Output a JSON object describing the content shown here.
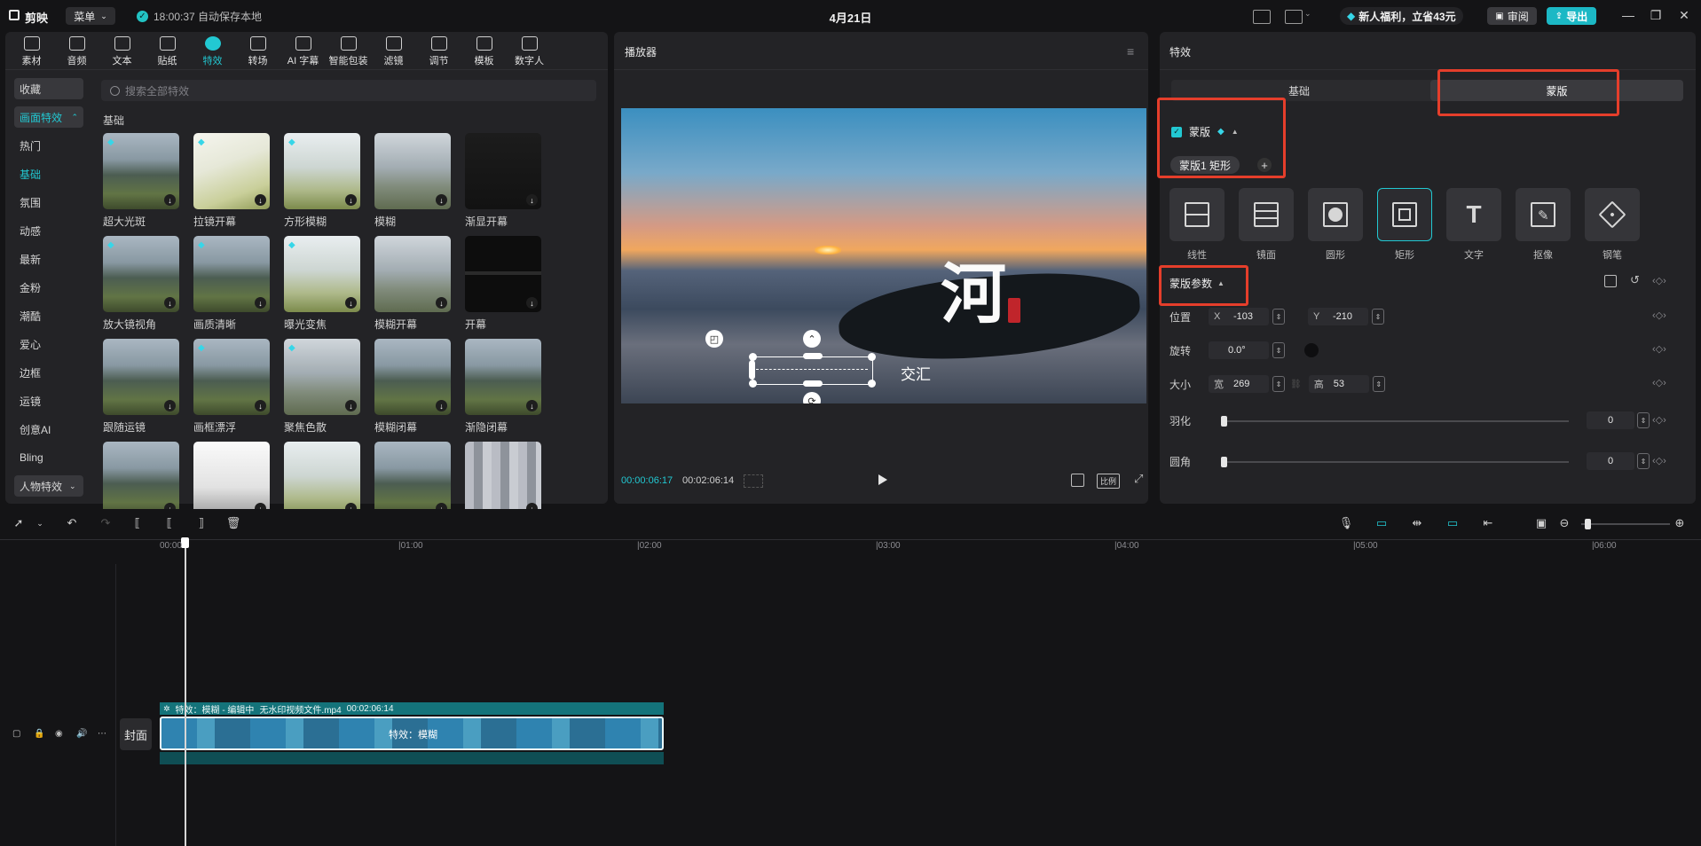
{
  "app": {
    "name": "剪映",
    "menu_label": "菜单",
    "save_status": "18:00:37 自动保存本地",
    "project_title": "4月21日",
    "promo_text": "新人福利，立省43元",
    "review_label": "审阅",
    "export_label": "导出",
    "accent_color": "#22c8d2"
  },
  "toolbar": {
    "tabs": [
      {
        "label": "素材",
        "icon": "media-icon"
      },
      {
        "label": "音频",
        "icon": "audio-icon"
      },
      {
        "label": "文本",
        "icon": "text-icon"
      },
      {
        "label": "贴纸",
        "icon": "sticker-icon"
      },
      {
        "label": "特效",
        "icon": "effects-icon",
        "active": true
      },
      {
        "label": "转场",
        "icon": "transition-icon"
      },
      {
        "label": "AI 字幕",
        "icon": "caption-icon"
      },
      {
        "label": "智能包装",
        "icon": "smart-pack-icon"
      },
      {
        "label": "滤镜",
        "icon": "filter-icon"
      },
      {
        "label": "调节",
        "icon": "adjust-icon"
      },
      {
        "label": "模板",
        "icon": "template-icon"
      },
      {
        "label": "数字人",
        "icon": "avatar-icon"
      }
    ]
  },
  "effects": {
    "categories": [
      {
        "label": "收藏",
        "style": "pill"
      },
      {
        "label": "画面特效",
        "style": "active-head"
      },
      {
        "label": "热门"
      },
      {
        "label": "基础",
        "active": true
      },
      {
        "label": "氛围"
      },
      {
        "label": "动感"
      },
      {
        "label": "最新"
      },
      {
        "label": "金粉"
      },
      {
        "label": "潮酷"
      },
      {
        "label": "爱心"
      },
      {
        "label": "边框"
      },
      {
        "label": "运镜"
      },
      {
        "label": "创意AI"
      },
      {
        "label": "Bling"
      },
      {
        "label": "人物特效",
        "style": "pill-dropdown"
      }
    ],
    "search_placeholder": "搜索全部特效",
    "section_title": "基础",
    "items": [
      {
        "label": "超大光斑",
        "theme": "t-forest",
        "vip": true
      },
      {
        "label": "拉镜开幕",
        "theme": "t-bright",
        "vip": true
      },
      {
        "label": "方形模糊",
        "theme": "t-light",
        "vip": true
      },
      {
        "label": "模糊",
        "theme": "t-blur",
        "vip": false
      },
      {
        "label": "渐显开幕",
        "theme": "t-dark",
        "vip": false
      },
      {
        "label": "放大镜视角",
        "theme": "t-forest",
        "vip": true
      },
      {
        "label": "画质清晰",
        "theme": "t-forest",
        "vip": true
      },
      {
        "label": "曝光变焦",
        "theme": "t-light",
        "vip": true
      },
      {
        "label": "模糊开幕",
        "theme": "t-blur",
        "vip": false
      },
      {
        "label": "开幕",
        "theme": "t-black",
        "vip": false
      },
      {
        "label": "跟随运镜",
        "theme": "t-forest",
        "vip": false
      },
      {
        "label": "画框漂浮",
        "theme": "t-forest",
        "vip": true
      },
      {
        "label": "聚焦色散",
        "theme": "t-blur",
        "vip": true
      },
      {
        "label": "模糊闭幕",
        "theme": "t-forest",
        "vip": false
      },
      {
        "label": "渐隐闭幕",
        "theme": "t-forest",
        "vip": false
      },
      {
        "label": "",
        "theme": "t-forest",
        "vip": false
      },
      {
        "label": "",
        "theme": "t-white",
        "vip": false
      },
      {
        "label": "",
        "theme": "t-light",
        "vip": false
      },
      {
        "label": "",
        "theme": "t-forest",
        "vip": false
      },
      {
        "label": "",
        "theme": "t-pixel",
        "vip": false
      }
    ]
  },
  "player": {
    "title": "播放器",
    "overlay_char": "河",
    "overlay_text": "交汇",
    "current_time": "00:00:06:17",
    "total_time": "00:02:06:14",
    "ratio_label": "比例"
  },
  "inspector": {
    "title": "特效",
    "tabs": [
      {
        "label": "基础"
      },
      {
        "label": "蒙版",
        "active": true
      }
    ],
    "mask_toggle_label": "蒙版",
    "mask_chip_label": "蒙版1 矩形",
    "mask_shapes": [
      {
        "label": "线性"
      },
      {
        "label": "镜面"
      },
      {
        "label": "圆形"
      },
      {
        "label": "矩形",
        "active": true
      },
      {
        "label": "文字"
      },
      {
        "label": "抠像"
      },
      {
        "label": "钢笔"
      }
    ],
    "params_title": "蒙版参数",
    "position": {
      "label": "位置",
      "x_label": "X",
      "x": "-103",
      "y_label": "Y",
      "y": "-210"
    },
    "rotation": {
      "label": "旋转",
      "value": "0.0°"
    },
    "size": {
      "label": "大小",
      "w_label": "宽",
      "w": "269",
      "h_label": "高",
      "h": "53"
    },
    "feather": {
      "label": "羽化",
      "value": "0",
      "level": 0
    },
    "corner": {
      "label": "圆角",
      "value": "0",
      "level": 0
    }
  },
  "timeline": {
    "ruler_labels": [
      "00:00",
      "|01:00",
      "|02:00",
      "|03:00",
      "|04:00",
      "|05:00",
      "|06:00"
    ],
    "cover_label": "封面",
    "clip_fx_label": "特效：模糊 - 编辑中",
    "clip_file_name": "无水印视频文件.mp4",
    "clip_duration": "00:02:06:14",
    "clip_effect_label": "特效：模糊"
  }
}
